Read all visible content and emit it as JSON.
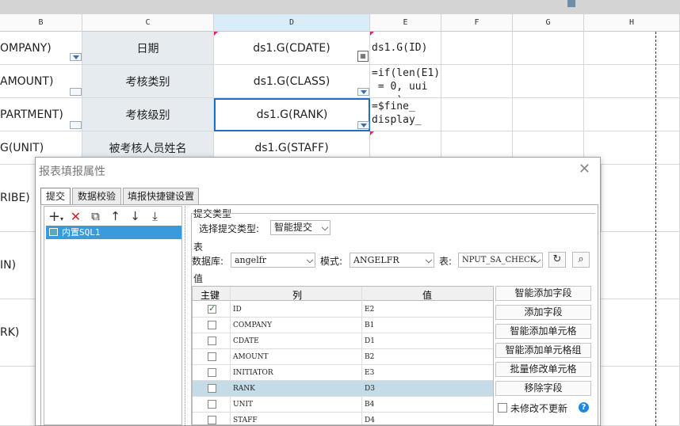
{
  "sheet": {
    "columns": [
      "B",
      "C",
      "D",
      "E",
      "F",
      "G",
      "H"
    ],
    "rows": [
      {
        "b": "OMPANY)",
        "c": "日期",
        "d": "ds1.G(CDATE)",
        "e": "ds1.G(ID)"
      },
      {
        "b": "AMOUNT)",
        "c": "考核类别",
        "d": "ds1.G(CLASS)",
        "e": "=if(len(E1)\n = 0, uui\n ...)"
      },
      {
        "b": "PARTMENT)",
        "c": "考核级别",
        "d": "ds1.G(RANK)",
        "e": "=$fine_\ndisplay_"
      },
      {
        "b": "G(UNIT)",
        "c": "被考核人员姓名",
        "d": "ds1.G(STAFF)",
        "e": ""
      },
      {
        "b": "RIBE)"
      },
      {
        "b": "IN)"
      },
      {
        "b": "RK)"
      }
    ]
  },
  "dialog": {
    "title": "报表填报属性",
    "close_icon": "close-icon",
    "tabs": [
      "提交",
      "数据校验",
      "填报快捷键设置"
    ],
    "toolbar_icons": [
      "add-icon",
      "delete-icon",
      "copy-icon",
      "move-up-icon",
      "move-down-icon",
      "move-bottom-icon"
    ],
    "tree_item": "内置SQL1",
    "submit_type_group": "提交类型",
    "submit_type_label": "选择提交类型:",
    "submit_type_value": "智能提交",
    "table_group": "表",
    "db_label": "数据库:",
    "db_value": "angelfr",
    "schema_label": "模式:",
    "schema_value": "ANGELFR",
    "table_label": "表:",
    "table_value": "NPUT_SA_CHECK",
    "value_group": "值",
    "grid_headers": [
      "主键",
      "列",
      "值"
    ],
    "grid_rows": [
      {
        "key": true,
        "col": "ID",
        "val": "E2"
      },
      {
        "key": false,
        "col": "COMPANY",
        "val": "B1"
      },
      {
        "key": false,
        "col": "CDATE",
        "val": "D1"
      },
      {
        "key": false,
        "col": "AMOUNT",
        "val": "B2"
      },
      {
        "key": false,
        "col": "INITIATOR",
        "val": "E3"
      },
      {
        "key": false,
        "col": "RANK",
        "val": "D3",
        "selected": true
      },
      {
        "key": false,
        "col": "UNIT",
        "val": "B4"
      },
      {
        "key": false,
        "col": "STAFF",
        "val": "D4"
      }
    ],
    "buttons": [
      "智能添加字段",
      "添加字段",
      "智能添加单元格",
      "智能添加单元格组",
      "批量修改单元格",
      "移除字段"
    ],
    "unchanged_label": "未修改不更新",
    "help_icon": "?"
  }
}
